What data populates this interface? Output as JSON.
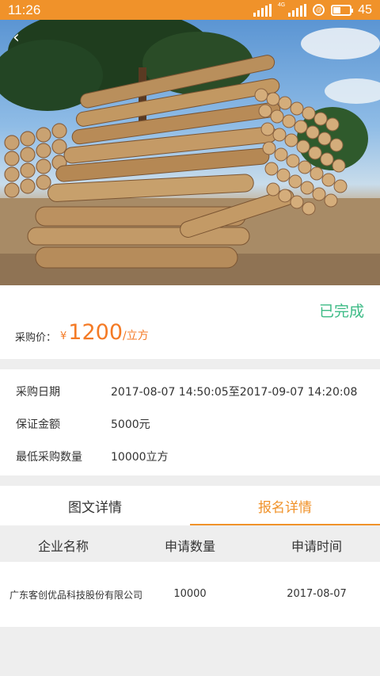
{
  "status_bar": {
    "time": "11:26",
    "network_label": "4G",
    "battery": "45",
    "battery_level_fraction": 0.45
  },
  "hero": {
    "image_alt": "stacked timber logs"
  },
  "price_card": {
    "status": "已完成",
    "price_label": "采购价：",
    "currency": "¥",
    "price": "1200",
    "unit": "/立方"
  },
  "info": [
    {
      "key": "采购日期",
      "value": "2017-08-07 14:50:05至2017-09-07 14:20:08"
    },
    {
      "key": "保证金额",
      "value": "5000元"
    },
    {
      "key": "最低采购数量",
      "value": "10000立方"
    }
  ],
  "tabs": [
    {
      "label": "图文详情",
      "active": false
    },
    {
      "label": "报名详情",
      "active": true
    }
  ],
  "table": {
    "headers": [
      "企业名称",
      "申请数量",
      "申请时间"
    ],
    "rows": [
      [
        "广东客创优品科技股份有限公司",
        "10000",
        "2017-08-07"
      ]
    ]
  },
  "colors": {
    "accent": "#f0922a",
    "price": "#f47a25",
    "status_done": "#3dbb86"
  }
}
